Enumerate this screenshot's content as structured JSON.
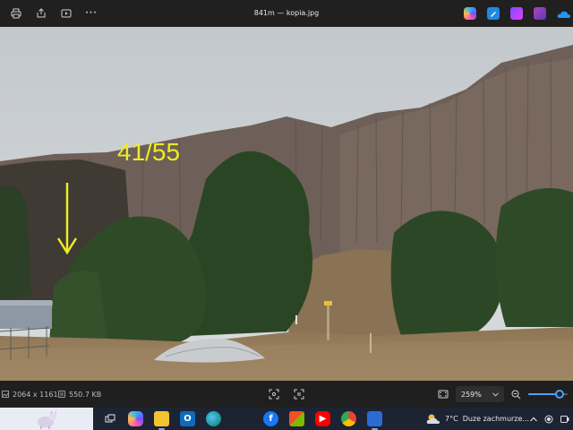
{
  "window": {
    "title": "841m — kopia.jpg"
  },
  "toolbar": {
    "left_icons": [
      "print-icon",
      "share-icon",
      "slideshow-icon",
      "more-icon"
    ],
    "more_label": "···",
    "right_apps": [
      "copilot-icon",
      "edit-icon",
      "clipchamp-icon",
      "photos-app-icon",
      "onedrive-icon"
    ]
  },
  "photo": {
    "overlay_text": "41/55",
    "overlay_color": "#ecec24",
    "arrow_color": "#ecec24",
    "description_icon": "arrow-down-icon"
  },
  "statusbar": {
    "dimensions": "2064 x 1161",
    "file_size": "550.7 KB",
    "zoom_value": "259%",
    "zoom_level_percent": 80
  },
  "taskbar": {
    "weather_temp": "7°C",
    "weather_text": "Duze zachmurze...",
    "accent": "#4ea1f3"
  }
}
